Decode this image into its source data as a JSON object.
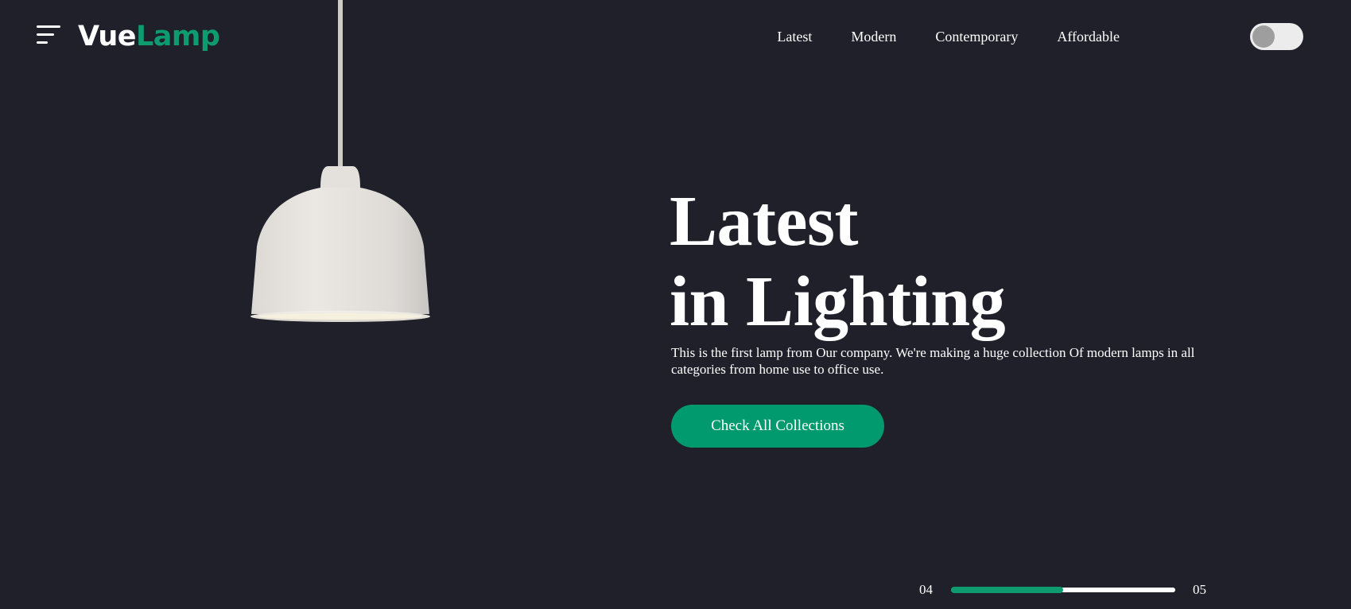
{
  "header": {
    "menu_icon": "hamburger-menu-icon",
    "logo": {
      "part1": "Vue",
      "part2": "Lamp"
    },
    "nav": [
      "Latest",
      "Modern",
      "Contemporary",
      "Affordable"
    ],
    "theme_toggle": {
      "state": "off"
    }
  },
  "hero": {
    "title_line1": "Latest",
    "title_line2": "in Lighting",
    "description": "This is the first lamp from Our company. We're making a huge collection Of modern lamps in all categories from home use to office use.",
    "cta_label": "Check All Collections"
  },
  "slider": {
    "current": "04",
    "total": "05",
    "progress": 0.5
  },
  "colors": {
    "background": "#1f2029",
    "accent": "#0e9b70",
    "button": "#009a6e",
    "text": "#ffffff"
  }
}
